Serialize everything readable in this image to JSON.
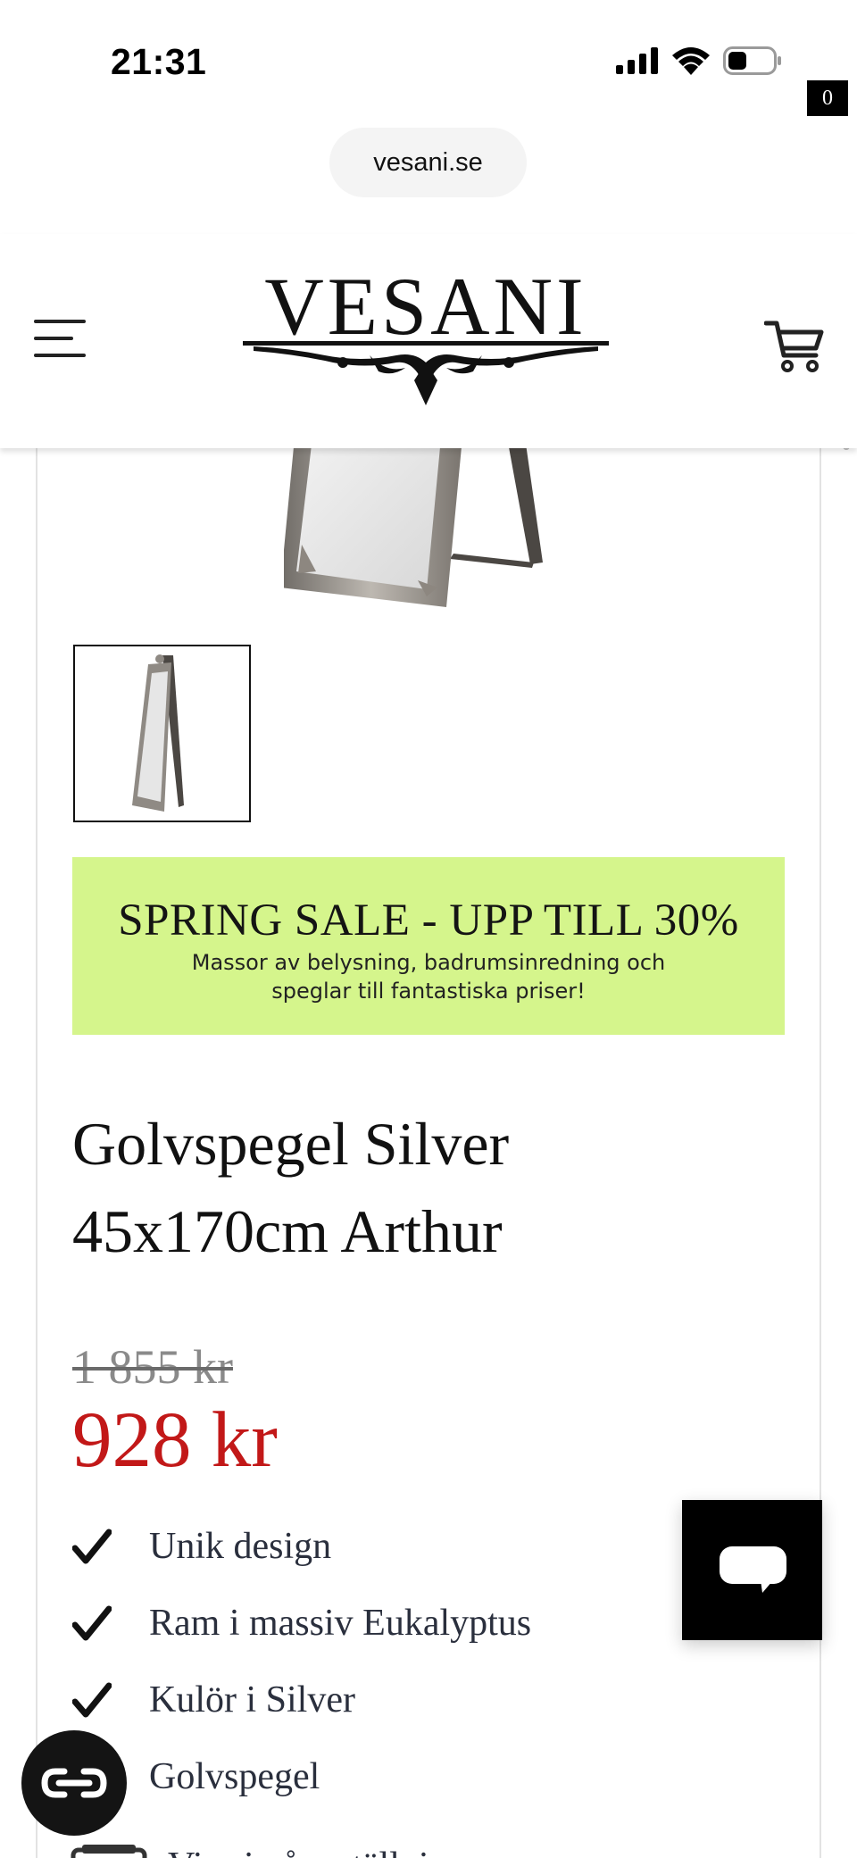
{
  "status_bar": {
    "time": "21:31",
    "icons": [
      "signal-icon",
      "wifi-icon",
      "battery-icon"
    ]
  },
  "browser": {
    "url": "vesani.se"
  },
  "header": {
    "logo_text": "VESANI",
    "cart_count": "0",
    "icons": [
      "hamburger-menu-icon",
      "cart-icon"
    ]
  },
  "promo": {
    "title": "SPRING SALE - UPP TILL 30%",
    "text": "Massor av belysning, badrumsinredning och speglar till fantastiska priser!",
    "background_color": "#d5f58c"
  },
  "product": {
    "title_line1": "Golvspegel Silver",
    "title_line2": "45x170cm Arthur",
    "old_price": "1 855 kr",
    "price": "928 kr",
    "price_color": "#c21818",
    "features": [
      {
        "label": "Unik design"
      },
      {
        "label": "Ram i massiv Eukalyptus"
      },
      {
        "label": "Kulör i Silver"
      },
      {
        "label": "Golvspegel"
      }
    ],
    "partial_row_text": "Visa i våra ställning"
  },
  "widgets": {
    "chat_icon": "chat-bubble-icon",
    "reader_icon": "reader-mode-icon"
  }
}
